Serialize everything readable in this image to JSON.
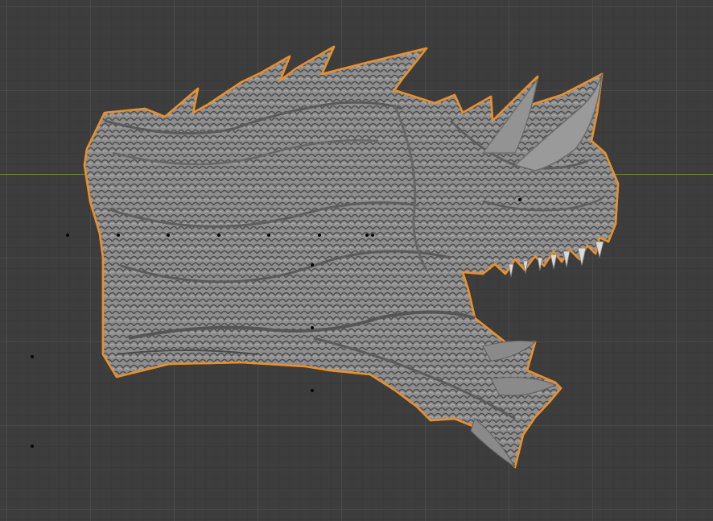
{
  "viewport": {
    "background_color": "#3d3d3d",
    "x_axis_color": "#6c8e32"
  },
  "object": {
    "icon": "dragon-head-sculpt-icon",
    "selection_outline_color": "#e8902d",
    "mesh_color": "#8c8c8c"
  }
}
